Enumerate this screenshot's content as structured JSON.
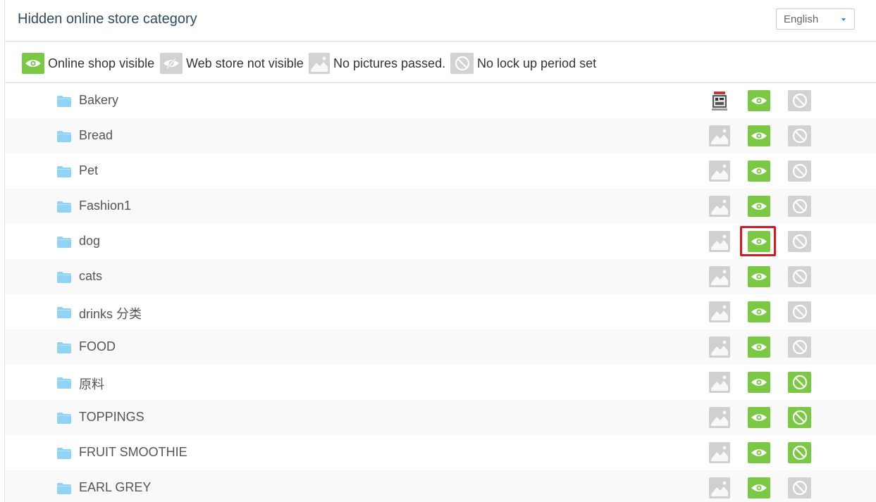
{
  "header": {
    "title": "Hidden online store category",
    "language": "English"
  },
  "legend": {
    "visible": "Online shop visible",
    "not_visible": "Web store not visible",
    "no_pictures": "No pictures passed.",
    "no_lock": "No lock up period set"
  },
  "colors": {
    "green": "#7ac943",
    "gray": "#d2d2d2",
    "highlight": "#e0141c",
    "folder": "#8fd3f7"
  },
  "categories": [
    {
      "name": "Bakery",
      "image": "thumbnail",
      "visible": true,
      "lock_set": false
    },
    {
      "name": "Bread",
      "image": "none",
      "visible": true,
      "lock_set": false
    },
    {
      "name": "Pet",
      "image": "none",
      "visible": true,
      "lock_set": false
    },
    {
      "name": "Fashion1",
      "image": "none",
      "visible": true,
      "lock_set": false
    },
    {
      "name": "dog",
      "image": "none",
      "visible": true,
      "lock_set": false,
      "highlighted": true
    },
    {
      "name": "cats",
      "image": "none",
      "visible": true,
      "lock_set": false
    },
    {
      "name": "drinks 分类",
      "image": "none",
      "visible": true,
      "lock_set": false
    },
    {
      "name": "FOOD",
      "image": "none",
      "visible": true,
      "lock_set": false
    },
    {
      "name": "原料",
      "image": "none",
      "visible": true,
      "lock_set": true
    },
    {
      "name": "TOPPINGS",
      "image": "none",
      "visible": true,
      "lock_set": true
    },
    {
      "name": "FRUIT SMOOTHIE",
      "image": "none",
      "visible": true,
      "lock_set": true
    },
    {
      "name": "EARL GREY",
      "image": "none",
      "visible": true,
      "lock_set": false
    }
  ]
}
